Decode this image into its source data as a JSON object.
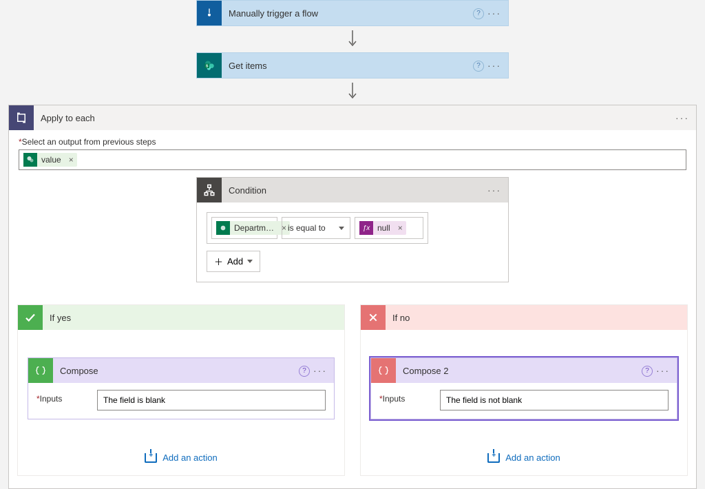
{
  "trigger": {
    "title": "Manually trigger a flow",
    "help_tooltip": "Help"
  },
  "get_items": {
    "title": "Get items",
    "help_tooltip": "Help"
  },
  "apply_to_each": {
    "title": "Apply to each",
    "output_label": "Select an output from previous steps",
    "value_token": "value"
  },
  "condition": {
    "title": "Condition",
    "left_token": "Departm…",
    "operator": "is equal to",
    "right_fx_label": "null",
    "add_label": "Add"
  },
  "branches": {
    "yes": {
      "title": "If yes",
      "compose": {
        "title": "Compose",
        "inputs_label": "Inputs",
        "inputs_value": "The field is blank"
      },
      "add_action": "Add an action"
    },
    "no": {
      "title": "If no",
      "compose": {
        "title": "Compose 2",
        "inputs_label": "Inputs",
        "inputs_value": "The field is not blank"
      },
      "add_action": "Add an action"
    }
  }
}
